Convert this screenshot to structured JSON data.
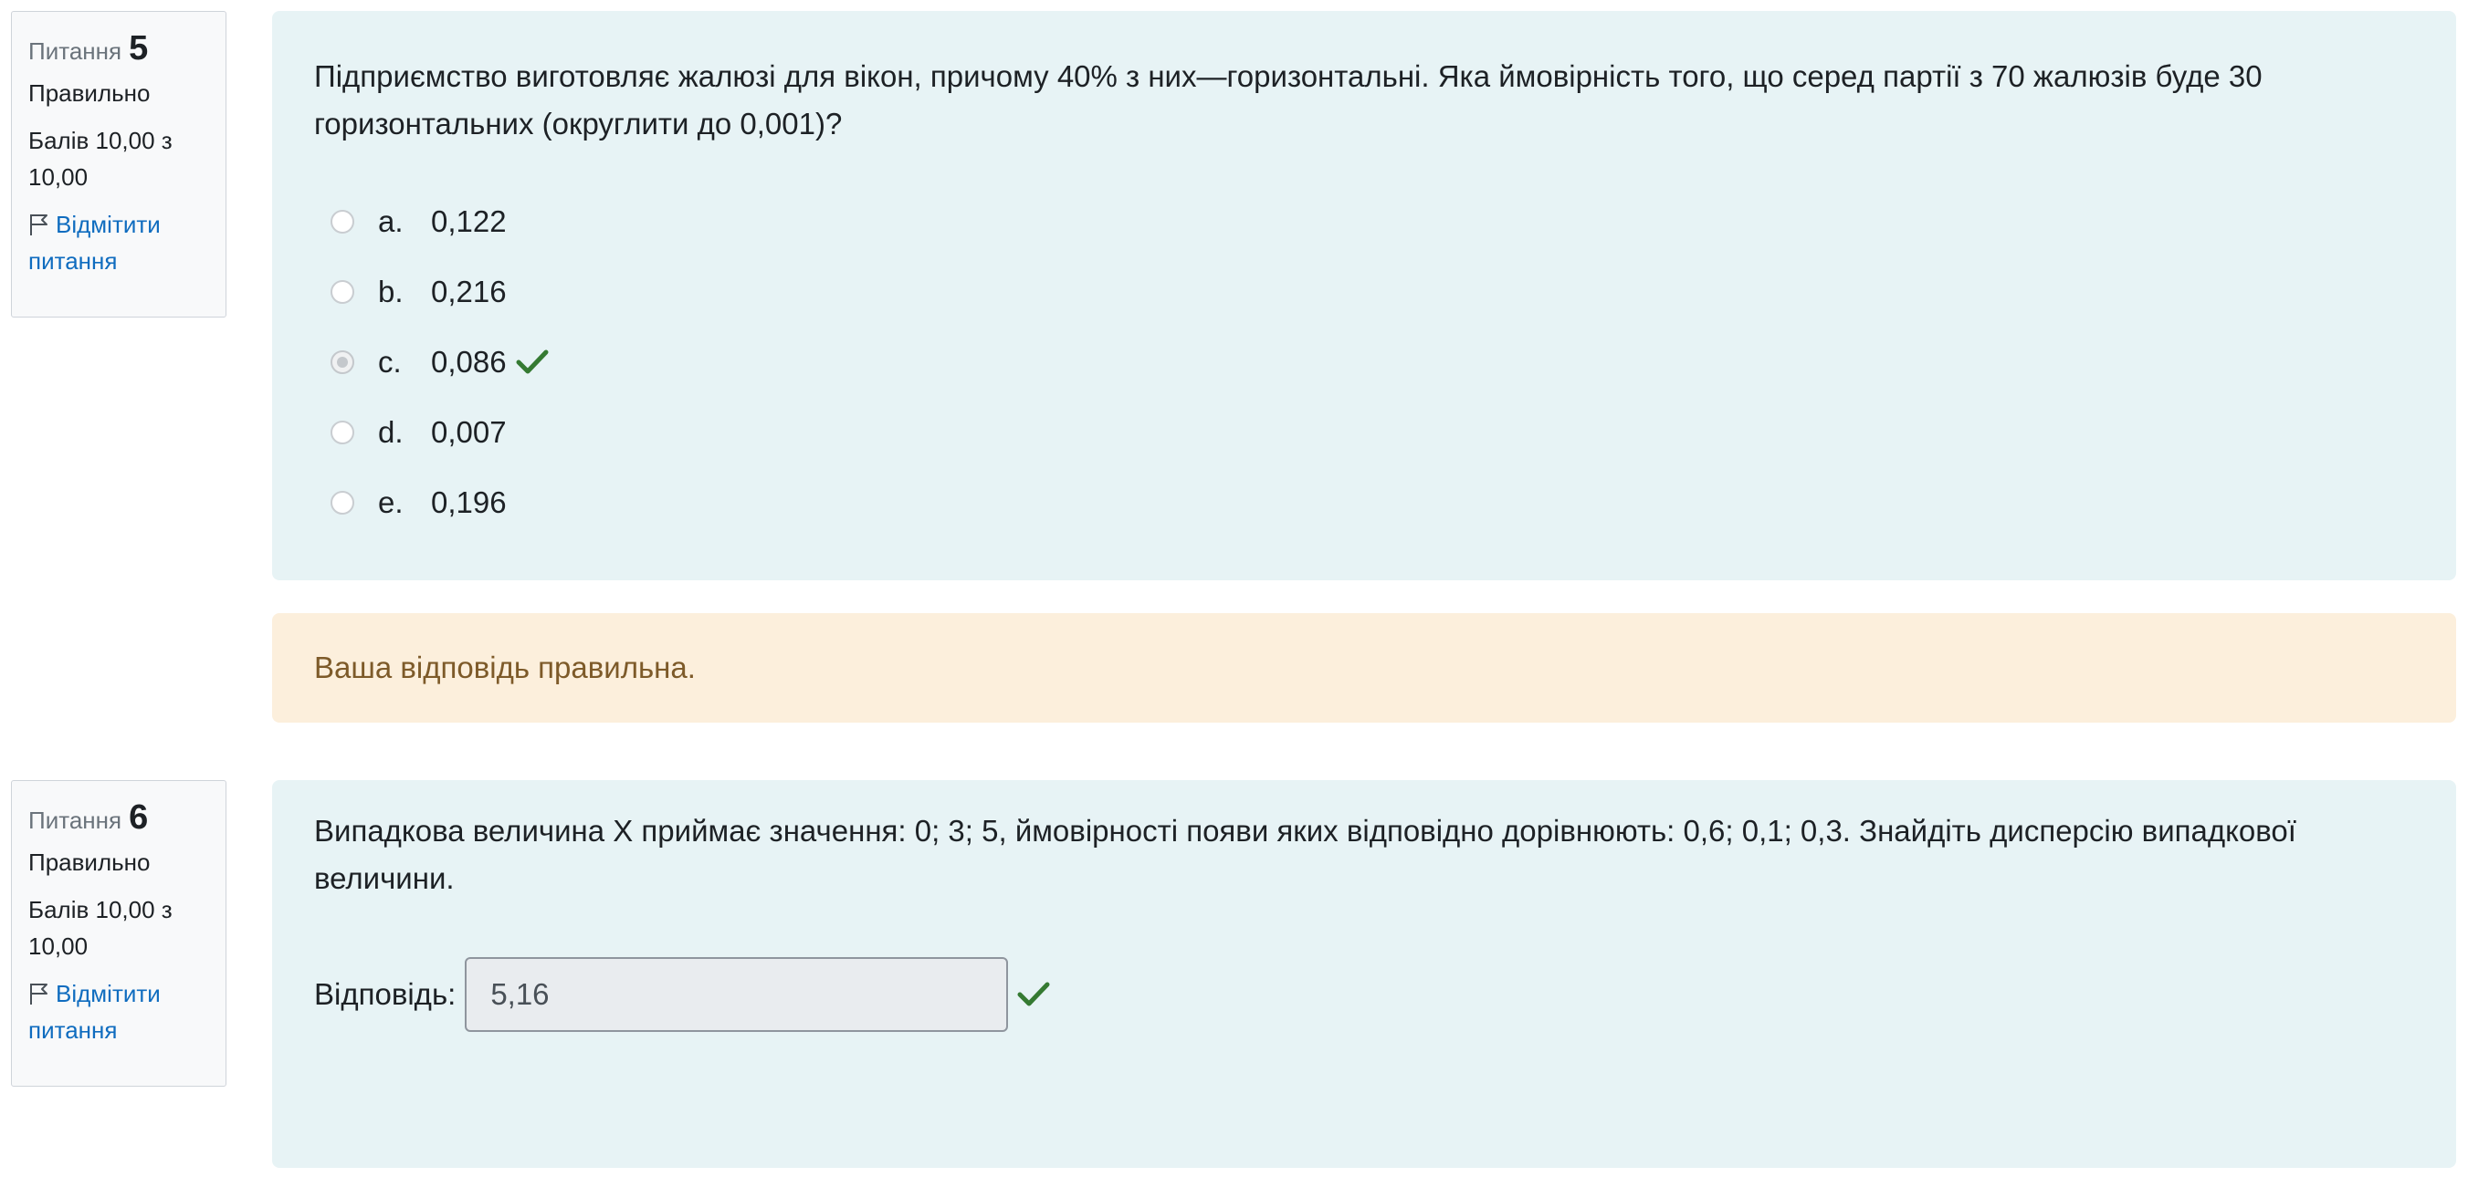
{
  "q5": {
    "label": "Питання",
    "number": "5",
    "state": "Правильно",
    "grade": "Балів 10,00 з 10,00",
    "flag_label": "Відмітити питання",
    "question_text": "Підприємство виготовляє жалюзі для вікон, причому 40% з них—горизонтальні. Яка ймовірність того, що серед партії з 70 жалюзів буде 30 горизонтальних (округлити до 0,001)?",
    "answers": [
      {
        "letter": "a.",
        "value": "0,122",
        "selected": false
      },
      {
        "letter": "b.",
        "value": "0,216",
        "selected": false
      },
      {
        "letter": "c.",
        "value": "0,086",
        "selected": true,
        "correct": true
      },
      {
        "letter": "d.",
        "value": "0,007",
        "selected": false
      },
      {
        "letter": "e.",
        "value": "0,196",
        "selected": false
      }
    ],
    "feedback": "Ваша відповідь правильна."
  },
  "q6": {
    "label": "Питання",
    "number": "6",
    "state": "Правильно",
    "grade": "Балів 10,00 з 10,00",
    "flag_label": "Відмітити питання",
    "question_text": "Випадкова величина X приймає значення: 0; 3; 5, ймовірності появи яких відповідно дорівнюють: 0,6; 0,1; 0,3. Знайдіть дисперсію випадкової величини.",
    "answer_label": "Відповідь:",
    "answer_value": "5,16"
  },
  "colors": {
    "accent_link": "#0f6cbf",
    "correct_check": "#357a32",
    "content_bg": "#e7f3f5",
    "feedback_bg": "#fcefdc",
    "feedback_text": "#7d5a29"
  }
}
